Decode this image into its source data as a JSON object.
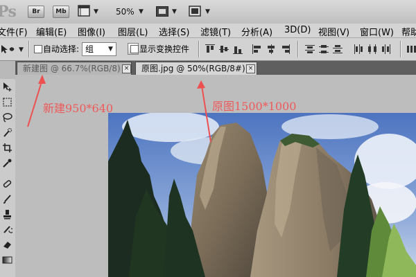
{
  "app": {
    "logo_text": "Ps",
    "br_label": "Br",
    "mb_label": "Mb",
    "zoom_level": "50%"
  },
  "menus": [
    {
      "label": "文件(F)"
    },
    {
      "label": "编辑(E)"
    },
    {
      "label": "图像(I)"
    },
    {
      "label": "图层(L)"
    },
    {
      "label": "选择(S)"
    },
    {
      "label": "滤镜(T)"
    },
    {
      "label": "分析(A)"
    },
    {
      "label": "3D(D)"
    },
    {
      "label": "视图(V)"
    },
    {
      "label": "窗口(W)"
    },
    {
      "label": "帮助"
    }
  ],
  "options": {
    "auto_select_label": "自动选择:",
    "auto_select_value": "组",
    "auto_select_checked": false,
    "show_transform_label": "显示变换控件",
    "show_transform_checked": false
  },
  "tabs": [
    {
      "title": "新建图 @ 66.7%(RGB/8)",
      "close": "×",
      "active": false
    },
    {
      "title": "原图.jpg @ 50%(RGB/8#)",
      "close": "×",
      "active": true
    }
  ],
  "annotations": {
    "new_doc": "新建950*640",
    "original": "原图1500*1000",
    "color": "#ee5a5a"
  },
  "colors": {
    "canvas_bg": "#bdbdbd",
    "tab_active": "#d6d6d6",
    "tab_inactive": "#b7b7b7"
  }
}
